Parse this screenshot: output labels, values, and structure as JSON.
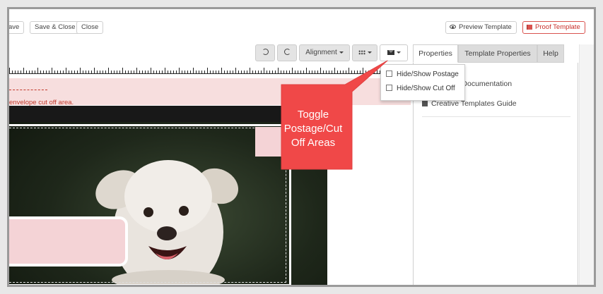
{
  "top_buttons": {
    "save": "ave",
    "save_close": "Save & Close",
    "close": "Close",
    "preview": "Preview Template",
    "proof": "Proof Template"
  },
  "toolbar": {
    "alignment": "Alignment",
    "undo_icon": "undo-icon",
    "redo_icon": "redo-icon",
    "grid_icon": "grid-icon",
    "envelope_icon": "envelope-icon"
  },
  "tabs": [
    {
      "label": "Properties",
      "active": true
    },
    {
      "label": "Template Properties",
      "active": false
    },
    {
      "label": "Help",
      "active": false
    }
  ],
  "dropdown": {
    "items": [
      "Hide/Show Postage",
      "Hide/Show Cut Off"
    ]
  },
  "panel": {
    "links": [
      "r Documentation",
      "Creative Templates Guide"
    ]
  },
  "canvas": {
    "warning_text": "envelope cut off area."
  },
  "callout": {
    "text": [
      "Toggle",
      "Postage/Cut",
      "Off Areas"
    ],
    "color": "#f04848"
  },
  "colors": {
    "pink_area": "#f4d3d6",
    "warning_text": "#c0392b",
    "proof_red": "#d9534f"
  }
}
